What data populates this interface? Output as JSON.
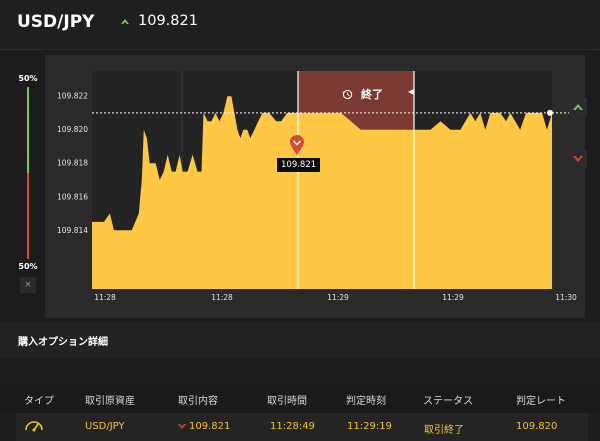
{
  "header": {
    "pair": "USD/JPY",
    "rate": "109.821",
    "trend": "up",
    "up_color": "#7ec64a"
  },
  "gauge": {
    "top_label": "50%",
    "bottom_label": "50%",
    "close_label": "×",
    "up_fraction": 0.5
  },
  "chart": {
    "end_label": "終了",
    "entry_rate_label": "109.821",
    "area_color": "#fec845",
    "expiry_zone_color": "#7a3a32"
  },
  "chart_data": {
    "type": "area",
    "x_tick_labels": [
      "11:28",
      "11:28",
      "11:29",
      "11:29",
      "11:30"
    ],
    "y_tick_labels": [
      "109.814",
      "109.816",
      "109.818",
      "109.820",
      "109.822"
    ],
    "ylim": [
      109.8105,
      109.8235
    ],
    "current_rate": 109.821,
    "series": [
      {
        "values": [
          [
            0,
            109.8145
          ],
          [
            4,
            109.8145
          ],
          [
            8,
            109.8145
          ],
          [
            12,
            109.8145
          ],
          [
            18,
            109.815
          ],
          [
            22,
            109.814
          ],
          [
            30,
            109.814
          ],
          [
            40,
            109.814
          ],
          [
            47,
            109.815
          ],
          [
            50,
            109.817
          ],
          [
            52,
            109.82
          ],
          [
            55,
            109.8195
          ],
          [
            58,
            109.818
          ],
          [
            64,
            109.818
          ],
          [
            68,
            109.817
          ],
          [
            72,
            109.8175
          ],
          [
            76,
            109.8185
          ],
          [
            80,
            109.8175
          ],
          [
            84,
            109.8175
          ],
          [
            88,
            109.8185
          ],
          [
            91,
            109.8175
          ],
          [
            96,
            109.8175
          ],
          [
            101,
            109.8185
          ],
          [
            106,
            109.8175
          ],
          [
            110,
            109.8175
          ],
          [
            112,
            109.821
          ],
          [
            116,
            109.8205
          ],
          [
            120,
            109.8205
          ],
          [
            124,
            109.821
          ],
          [
            128,
            109.8205
          ],
          [
            132,
            109.821
          ],
          [
            136,
            109.822
          ],
          [
            140,
            109.822
          ],
          [
            143,
            109.821
          ],
          [
            146,
            109.82
          ],
          [
            149,
            109.8195
          ],
          [
            152,
            109.82
          ],
          [
            156,
            109.82
          ],
          [
            159,
            109.8195
          ],
          [
            163,
            109.82
          ],
          [
            167,
            109.8205
          ],
          [
            171,
            109.821
          ],
          [
            178,
            109.821
          ],
          [
            185,
            109.8205
          ],
          [
            190,
            109.8205
          ],
          [
            196,
            109.821
          ],
          [
            204,
            109.821
          ],
          [
            212,
            109.821
          ],
          [
            218,
            109.821
          ],
          [
            222,
            109.821
          ],
          [
            230,
            109.821
          ],
          [
            240,
            109.821
          ],
          [
            250,
            109.821
          ],
          [
            260,
            109.8205
          ],
          [
            270,
            109.82
          ],
          [
            280,
            109.82
          ],
          [
            290,
            109.82
          ],
          [
            300,
            109.82
          ],
          [
            310,
            109.82
          ],
          [
            320,
            109.82
          ],
          [
            330,
            109.82
          ],
          [
            340,
            109.82
          ],
          [
            350,
            109.8205
          ],
          [
            360,
            109.82
          ],
          [
            370,
            109.82
          ],
          [
            375,
            109.8205
          ],
          [
            380,
            109.821
          ],
          [
            385,
            109.8205
          ],
          [
            390,
            109.821
          ],
          [
            395,
            109.82
          ],
          [
            400,
            109.821
          ],
          [
            405,
            109.821
          ],
          [
            410,
            109.821
          ],
          [
            416,
            109.8205
          ],
          [
            420,
            109.821
          ],
          [
            425,
            109.8205
          ],
          [
            430,
            109.82
          ],
          [
            436,
            109.821
          ],
          [
            442,
            109.821
          ],
          [
            446,
            109.821
          ],
          [
            452,
            109.821
          ],
          [
            457,
            109.82
          ],
          [
            462,
            109.821
          ]
        ]
      }
    ]
  },
  "side_buttons": {
    "up_label": "High",
    "down_label": "Low"
  },
  "details": {
    "title": "購入オプション詳細",
    "columns": [
      "タイプ",
      "取引原資産",
      "取引内容",
      "取引時間",
      "判定時刻",
      "ステータス",
      "判定レート"
    ],
    "row": {
      "asset": "USD/JPY",
      "direction": "down",
      "entry_rate": "109.821",
      "trade_time": "11:28:49",
      "judge_time": "11:29:19",
      "status": "取引終了",
      "judge_rate": "109.820"
    },
    "down_color": "#d24a39",
    "value_color": "#f3c332"
  }
}
